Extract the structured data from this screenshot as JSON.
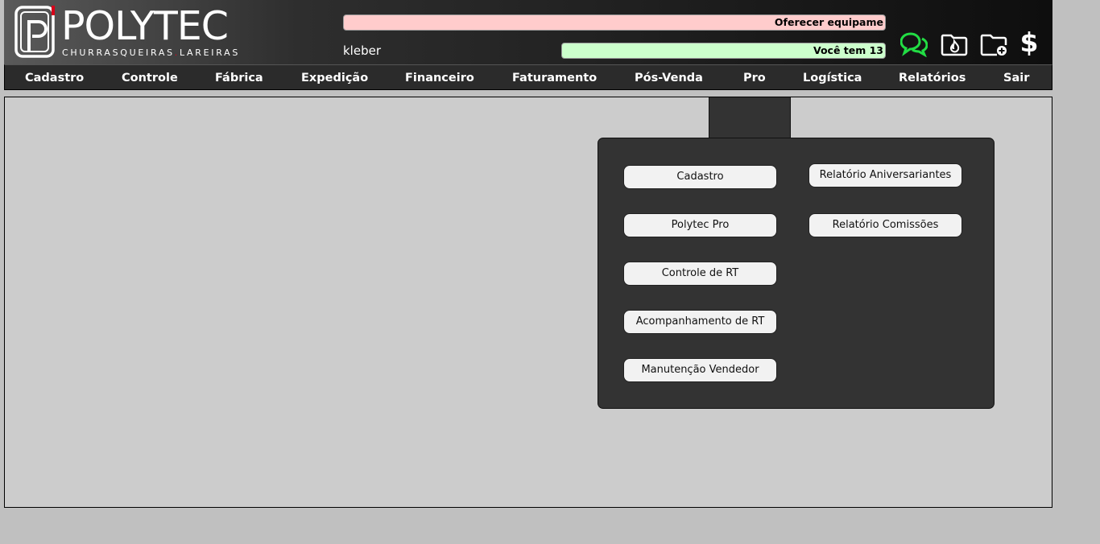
{
  "brand": {
    "name": "POLYTEC",
    "tagline_part1": "CHURRASQUEIRAS",
    "tagline_dot": ".",
    "tagline_part2": "LAREIRAS",
    "accent_color": "#d8001a"
  },
  "header": {
    "ticker_top": "Oferecer equipame",
    "ticker_bottom": "Você tem 13",
    "username": "kleber",
    "ticker_top_color": "#ffcccc",
    "ticker_bottom_color": "#ccffcc",
    "icons": [
      "chat-icon",
      "fire-folder-icon",
      "add-folder-icon",
      "dollar-icon"
    ],
    "chat_icon_color": "#22dd44",
    "dollar_symbol": "$"
  },
  "nav": {
    "items": [
      {
        "label": "Cadastro"
      },
      {
        "label": "Controle"
      },
      {
        "label": "Fábrica"
      },
      {
        "label": "Expedição"
      },
      {
        "label": "Financeiro"
      },
      {
        "label": "Faturamento"
      },
      {
        "label": "Pós-Venda"
      },
      {
        "label": "Pro"
      },
      {
        "label": "Logística"
      },
      {
        "label": "Relatórios"
      },
      {
        "label": "Sair"
      }
    ]
  },
  "submenu": {
    "left_column": [
      {
        "label": "Cadastro"
      },
      {
        "label": "Polytec Pro"
      },
      {
        "label": "Controle de RT"
      },
      {
        "label": "Acompanhamento de RT"
      },
      {
        "label": "Manutenção Vendedor"
      }
    ],
    "right_column": [
      {
        "label": "Relatório Aniversariantes"
      },
      {
        "label": "Relatório Comissões"
      }
    ]
  }
}
